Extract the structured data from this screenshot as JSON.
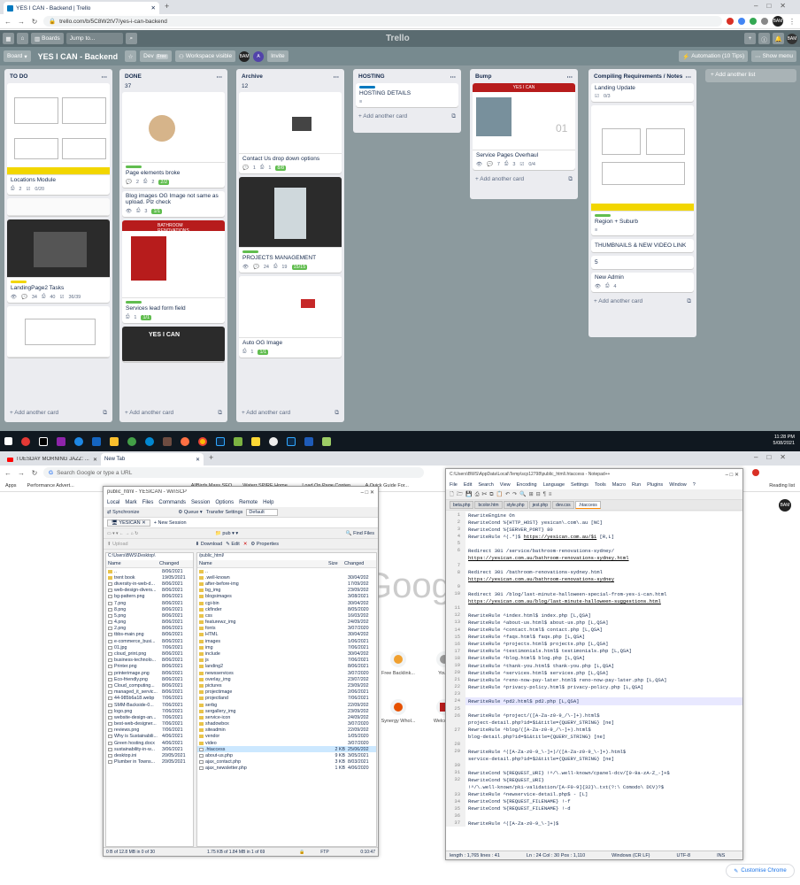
{
  "browser_top": {
    "tab_title": "YES I CAN - Backend | Trello",
    "url": "trello.com/b/5C8W2tV7/yes-i-can-backend"
  },
  "trello": {
    "boards_label": "Boards",
    "jump_placeholder": "Jump to...",
    "logo": "Trello",
    "board_menu": "Board",
    "board_title": "YES I CAN - Backend",
    "dev_label": "Dev",
    "free_label": "Free",
    "workspace_label": "Workspace visible",
    "avatar_initials": "BAM",
    "invite": "Invite",
    "automation": "Automation (10 Tips)",
    "show_menu": "Show menu",
    "add_another_list": "+ Add another list",
    "add_card": "+ Add another card",
    "lists": [
      {
        "title": "TO DO",
        "cards": [
          {
            "title": "Locations Module",
            "badges": [
              "2",
              "0/20"
            ]
          },
          {
            "title": "LandingPage2 Tasks",
            "badges": [
              "34",
              "40",
              "36/39"
            ]
          }
        ]
      },
      {
        "title": "DONE",
        "count": "37",
        "cards": [
          {
            "title": "Page elements broke",
            "badges": [
              "2",
              "2",
              "2/2"
            ]
          },
          {
            "title": "Blog images OG Image not same as upload. Plz check",
            "badges": [
              "3",
              "1/1"
            ]
          },
          {
            "title": "Services lead form field",
            "badges": [
              "1",
              "1/1"
            ]
          }
        ]
      },
      {
        "title": "Archive",
        "count": "12",
        "cards": [
          {
            "title": "Contact Us drop down options",
            "badges": [
              "1",
              "1",
              "8/8"
            ]
          },
          {
            "title": "PROJECTS MANAGEMENT",
            "badges": [
              "24",
              "19",
              "15/15"
            ]
          },
          {
            "title": "Auto OG Image",
            "badges": [
              "1",
              "1/1"
            ]
          }
        ]
      },
      {
        "title": "HOSTING",
        "cards": [
          {
            "title": "HOSTING DETAILS",
            "badges": []
          }
        ]
      },
      {
        "title": "Bump",
        "cards": [
          {
            "title": "Service Pages Overhaul",
            "badges": [
              "7",
              "3",
              "0/4"
            ]
          }
        ]
      },
      {
        "title": "Compiling Requirements / Notes",
        "cards": [
          {
            "title": "Landing Update",
            "badges": [
              "0/3"
            ]
          },
          {
            "title": "Region + Suburb",
            "badges": []
          },
          {
            "title": "THUMBNAILS & NEW VIDEO LINK",
            "badges": []
          },
          {
            "title": "5",
            "badges": []
          },
          {
            "title": "New Admin",
            "badges": [
              "4"
            ]
          }
        ]
      }
    ],
    "thumb_texts": {
      "yesican": "YES I CAN",
      "bathroom": "BATHROOM RENOVATIONS",
      "num01": "01"
    }
  },
  "taskbar": {
    "time": "11:28 PM",
    "date": "5/08/2021"
  },
  "browser_bottom": {
    "tab1": "TUESDAY MORNING JAZZ: ...",
    "tab2": "New Tab",
    "omnibox_placeholder": "Search Google or type a URL",
    "bookmarks": [
      "Apps",
      "Performance Advert...",
      "AllBirds Mass SEO",
      "Waterr SPIRE Home...",
      "Load On Page Conten...",
      "A Quick Guide For...",
      "Reading list"
    ],
    "google_logo": "Google",
    "shortcuts": [
      "Free Backlink...",
      "You...",
      "Synergy Whol...",
      "Welcom..."
    ],
    "customise": "Customise Chrome"
  },
  "winscp": {
    "title": "public_html - YESICAN - WinSCP",
    "menu": [
      "Local",
      "Mark",
      "Files",
      "Commands",
      "Session",
      "Options",
      "Remote",
      "Help"
    ],
    "toolbar": [
      "Synchronize",
      "Queue",
      "Transfer Settings",
      "Default"
    ],
    "session_tab": "YESICAN",
    "new_session": "New Session",
    "local_path": "C:\\Users\\BWS\\Desktop\\",
    "remote_path": "/public_html/",
    "local_headers": [
      "Name",
      "Changed"
    ],
    "remote_headers": [
      "Name",
      "Size",
      "Changed"
    ],
    "upload": "Upload",
    "download": "Download",
    "edit": "Edit",
    "properties": "Properties",
    "find_files": "Find Files",
    "local_files": [
      [
        "..",
        "8/06/2021"
      ],
      [
        "trent book",
        "19/05/2021"
      ],
      [
        "diversity-in-web-d...",
        "8/06/2021"
      ],
      [
        "web-design-divers...",
        "8/06/2021"
      ],
      [
        "bg-pattern.png",
        "8/06/2021"
      ],
      [
        "7.png",
        "8/06/2021"
      ],
      [
        "8.png",
        "8/06/2021"
      ],
      [
        "5.png",
        "8/06/2021"
      ],
      [
        "4.png",
        "8/06/2021"
      ],
      [
        "2.png",
        "8/06/2021"
      ],
      [
        "tbbs-main.png",
        "8/06/2021"
      ],
      [
        "e-commerce_busi...",
        "8/06/2021"
      ],
      [
        "01.jpg",
        "7/06/2021"
      ],
      [
        "cloud_print.png",
        "8/06/2021"
      ],
      [
        "business-technolo...",
        "8/06/2021"
      ],
      [
        "Printer.png",
        "8/06/2021"
      ],
      [
        "printerimage.png",
        "8/06/2021"
      ],
      [
        "Eco-friendly.png",
        "8/06/2021"
      ],
      [
        "Cloud_computing...",
        "8/06/2021"
      ],
      [
        "managed_it_servic...",
        "8/06/2021"
      ],
      [
        "44-985b6a18.webp",
        "7/06/2021"
      ],
      [
        "SMM-Backside-0...",
        "7/06/2021"
      ],
      [
        "logo.png",
        "7/06/2021"
      ],
      [
        "website-design-an...",
        "7/06/2021"
      ],
      [
        "best-web-designer...",
        "7/06/2021"
      ],
      [
        "reviews.png",
        "7/06/2021"
      ],
      [
        "Why is Sustainabili...",
        "4/06/2021"
      ],
      [
        "Green hosting.docx",
        "4/06/2021"
      ],
      [
        "sustainability-in-w...",
        "3/06/2021"
      ],
      [
        "desktop.ini",
        "20/05/2021"
      ],
      [
        "Plumber in Towns...",
        "20/05/2021"
      ]
    ],
    "remote_files": [
      [
        "..",
        "",
        ""
      ],
      [
        ".well-known",
        "",
        "30/04/202"
      ],
      [
        "after-before-img",
        "",
        "17/09/202"
      ],
      [
        "bg_img",
        "",
        "23/09/202"
      ],
      [
        "blogsimages",
        "",
        "3/08/2021"
      ],
      [
        "cgi-bin",
        "",
        "30/04/202"
      ],
      [
        "ckfinder",
        "",
        "8/05/2020"
      ],
      [
        "css",
        "",
        "16/03/202"
      ],
      [
        "featurewz_img",
        "",
        "24/09/202"
      ],
      [
        "fonts",
        "",
        "3/07/2020"
      ],
      [
        "HTML",
        "",
        "30/04/202"
      ],
      [
        "images",
        "",
        "1/06/2021"
      ],
      [
        "img",
        "",
        "7/06/2021"
      ],
      [
        "include",
        "",
        "30/04/202"
      ],
      [
        "js",
        "",
        "7/06/2021"
      ],
      [
        "landing2",
        "",
        "8/06/2021"
      ],
      [
        "newsservices",
        "",
        "3/07/2020"
      ],
      [
        "overlay_img",
        "",
        "23/07/202"
      ],
      [
        "pictures",
        "",
        "23/09/202"
      ],
      [
        "projectimage",
        "",
        "2/06/2021"
      ],
      [
        "projectland",
        "",
        "7/06/2021"
      ],
      [
        "serbg",
        "",
        "22/09/202"
      ],
      [
        "sergallery_img",
        "",
        "23/09/202"
      ],
      [
        "service-icon",
        "",
        "24/09/202"
      ],
      [
        "shadowbox",
        "",
        "3/07/2020"
      ],
      [
        "siteadmin",
        "",
        "22/09/202"
      ],
      [
        "vendor",
        "",
        "1/05/2020"
      ],
      [
        "video",
        "",
        "3/07/2020"
      ],
      [
        ".htaccess",
        "2 KB",
        "25/06/202"
      ],
      [
        "about-us.php",
        "9 KB",
        "3/05/2021"
      ],
      [
        "ajax_contact.php",
        "3 KB",
        "8/03/2021"
      ],
      [
        "ajax_newsletter.php",
        "1 KB",
        "4/06/2020"
      ]
    ],
    "local_status": "0 B of 12.8 MB in 0 of 30",
    "remote_status": "1.75 KB of 1.84 MB in 1 of 69",
    "proto": "FTP",
    "elapsed": "0:10:47"
  },
  "notepad": {
    "title": "C:\\Users\\BWS\\AppData\\Local\\Temp\\scp12798\\public_html\\.htaccess - Notepad++",
    "menu": [
      "File",
      "Edit",
      "Search",
      "View",
      "Encoding",
      "Language",
      "Settings",
      "Tools",
      "Macro",
      "Run",
      "Plugins",
      "Window",
      "?"
    ],
    "tabs": [
      "beta.php",
      "bcolor.htm",
      "style.php",
      "jest.php",
      "dev.css",
      ".htaccess"
    ],
    "lines": [
      {
        "n": "1",
        "t": "RewriteEngine On"
      },
      {
        "n": "2",
        "t": "RewriteCond %{HTTP_HOST} yesican\\.com\\.au [NC]"
      },
      {
        "n": "3",
        "t": "RewriteCond %{SERVER_PORT} 80"
      },
      {
        "n": "4",
        "t": "RewriteRule ^(.*)$ ",
        "u": "https://yesican.com.au/$1",
        "r": " [R,L]"
      },
      {
        "n": "5",
        "t": ""
      },
      {
        "n": "6",
        "t": "Redirect 301 /service/bathroom-renovations-sydney/"
      },
      {
        "n": "",
        "t": "",
        "u": "https://yesican.com.au/bathroom-renovations-sydney.html"
      },
      {
        "n": "7",
        "t": ""
      },
      {
        "n": "8",
        "t": "Redirect 301 /bathroom-renovations-sydney.html"
      },
      {
        "n": "",
        "t": "",
        "u": "https://yesican.com.au/bathroom-renovations-sydney"
      },
      {
        "n": "9",
        "t": ""
      },
      {
        "n": "10",
        "t": "Redirect 301 /blog/last-minute-halloween-special-from-yes-i-can.html"
      },
      {
        "n": "",
        "t": "",
        "u": "https://yesican.com.au/blog/last-minute-halloween-suggestions.html"
      },
      {
        "n": "11",
        "t": ""
      },
      {
        "n": "12",
        "t": "RewriteRule ^index.html$ index.php [L,QSA]"
      },
      {
        "n": "13",
        "t": "RewriteRule ^about-us.html$ about-us.php [L,QSA]"
      },
      {
        "n": "14",
        "t": "RewriteRule ^contact.html$ contact.php [L,QSA]"
      },
      {
        "n": "15",
        "t": "RewriteRule ^faqs.html$ faqs.php [L,QSA]"
      },
      {
        "n": "16",
        "t": "RewriteRule ^projects.html$ projects.php [L,QSA]"
      },
      {
        "n": "17",
        "t": "RewriteRule ^testimonials.html$ testimonials.php [L,QSA]"
      },
      {
        "n": "18",
        "t": "RewriteRule ^blog.html$ blog.php [L,QSA]"
      },
      {
        "n": "19",
        "t": "RewriteRule ^thank-you.html$ thank-you.php [L,QSA]"
      },
      {
        "n": "20",
        "t": "RewriteRule ^services.html$ services.php [L,QSA]"
      },
      {
        "n": "21",
        "t": "RewriteRule ^reno-now-pay-later.html$ reno-now-pay-later.php [L,QSA]"
      },
      {
        "n": "22",
        "t": "RewriteRule ^privacy-policy.html$ privacy-policy.php [L,QSA]"
      },
      {
        "n": "23",
        "t": ""
      },
      {
        "n": "24",
        "t": "RewriteRule ^pd2.html$ pd2.php [L,QSA]",
        "hl": true
      },
      {
        "n": "25",
        "t": ""
      },
      {
        "n": "26",
        "t": "RewriteRule ^project/([A-Za-z0-9_/\\-]+).html$"
      },
      {
        "n": "",
        "t": "project-detail.php?id=$1&title={QUERY_STRING} [ne]"
      },
      {
        "n": "27",
        "t": "RewriteRule ^blog/([A-Za-z0-9_/\\-]+).html$"
      },
      {
        "n": "",
        "t": "blog-detail.php?id=$1&title={QUERY_STRING} [ne]"
      },
      {
        "n": "28",
        "t": ""
      },
      {
        "n": "29",
        "t": "RewriteRule ^([A-Za-z0-9_\\-]+)/([A-Za-z0-9_\\-]+).html$"
      },
      {
        "n": "",
        "t": "service-detail.php?id=$2&title={QUERY_STRING} [ne]"
      },
      {
        "n": "30",
        "t": ""
      },
      {
        "n": "31",
        "t": "RewriteCond %{REQUEST_URI} !^/\\.well-known/cpanel-dcv/[0-9a-zA-Z_-]+$"
      },
      {
        "n": "32",
        "t": "RewriteCond %{REQUEST_URI}"
      },
      {
        "n": "",
        "t": "!^/\\.well-known/pki-validation/[A-F0-9]{32}\\.txt(?:\\ Comodo\\ DCV)?$"
      },
      {
        "n": "33",
        "t": "RewriteRule ^newservice-detail.php$ - [L]"
      },
      {
        "n": "34",
        "t": "RewriteCond %{REQUEST_FILENAME} !-f"
      },
      {
        "n": "35",
        "t": "RewriteCond %{REQUEST_FILENAME} !-d"
      },
      {
        "n": "36",
        "t": ""
      },
      {
        "n": "37",
        "t": "RewriteRule ^([A-Za-z0-9_\\-]+)$"
      }
    ],
    "status_length": "length : 1,765    lines : 41",
    "status_pos": "Ln : 24    Col : 30    Pos : 1,110",
    "status_eol": "Windows (CR LF)",
    "status_enc": "UTF-8",
    "status_ins": "INS"
  }
}
